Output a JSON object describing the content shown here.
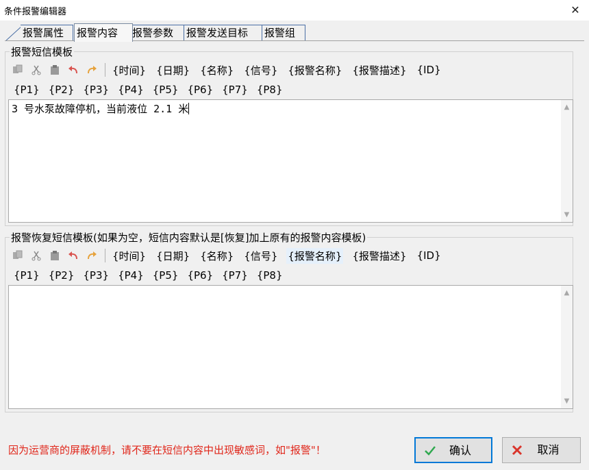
{
  "window": {
    "title": "条件报警编辑器",
    "close_glyph": "✕"
  },
  "tabs": [
    {
      "label": "报警属性"
    },
    {
      "label": "报警内容"
    },
    {
      "label": "报警参数"
    },
    {
      "label": "报警发送目标"
    },
    {
      "label": "报警组"
    }
  ],
  "active_tab": "报警内容",
  "sms_group": {
    "label": "报警短信模板",
    "tokens_row1": [
      "{时间}",
      "{日期}",
      "{名称}",
      "{信号}",
      "{报警名称}",
      "{报警描述}",
      "{ID}"
    ],
    "tokens_row2": [
      "{P1}",
      "{P2}",
      "{P3}",
      "{P4}",
      "{P5}",
      "{P6}",
      "{P7}",
      "{P8}"
    ],
    "content": "3 号水泵故障停机，当前液位 2.1 米"
  },
  "recovery_group": {
    "label": "报警恢复短信模板(如果为空，短信内容默认是[恢复]加上原有的报警内容模板)",
    "tokens_row1": [
      "{时间}",
      "{日期}",
      "{名称}",
      "{信号}",
      "{报警名称}",
      "{报警描述}",
      "{ID}"
    ],
    "tokens_row2": [
      "{P1}",
      "{P2}",
      "{P3}",
      "{P4}",
      "{P5}",
      "{P6}",
      "{P7}",
      "{P8}"
    ],
    "content": ""
  },
  "toolbar_icons": [
    "copy-icon",
    "cut-icon",
    "paste-icon",
    "undo-icon",
    "redo-icon"
  ],
  "warning_text": "因为运营商的屏蔽机制，请不要在短信内容中出现敏感词，如\"报警\"！",
  "buttons": {
    "ok_label": "确认",
    "cancel_label": "取消"
  },
  "colors": {
    "warning": "#e0261a",
    "ok_check": "#2fa84f",
    "cancel_x": "#d9342b",
    "focus_border": "#0078d7"
  }
}
